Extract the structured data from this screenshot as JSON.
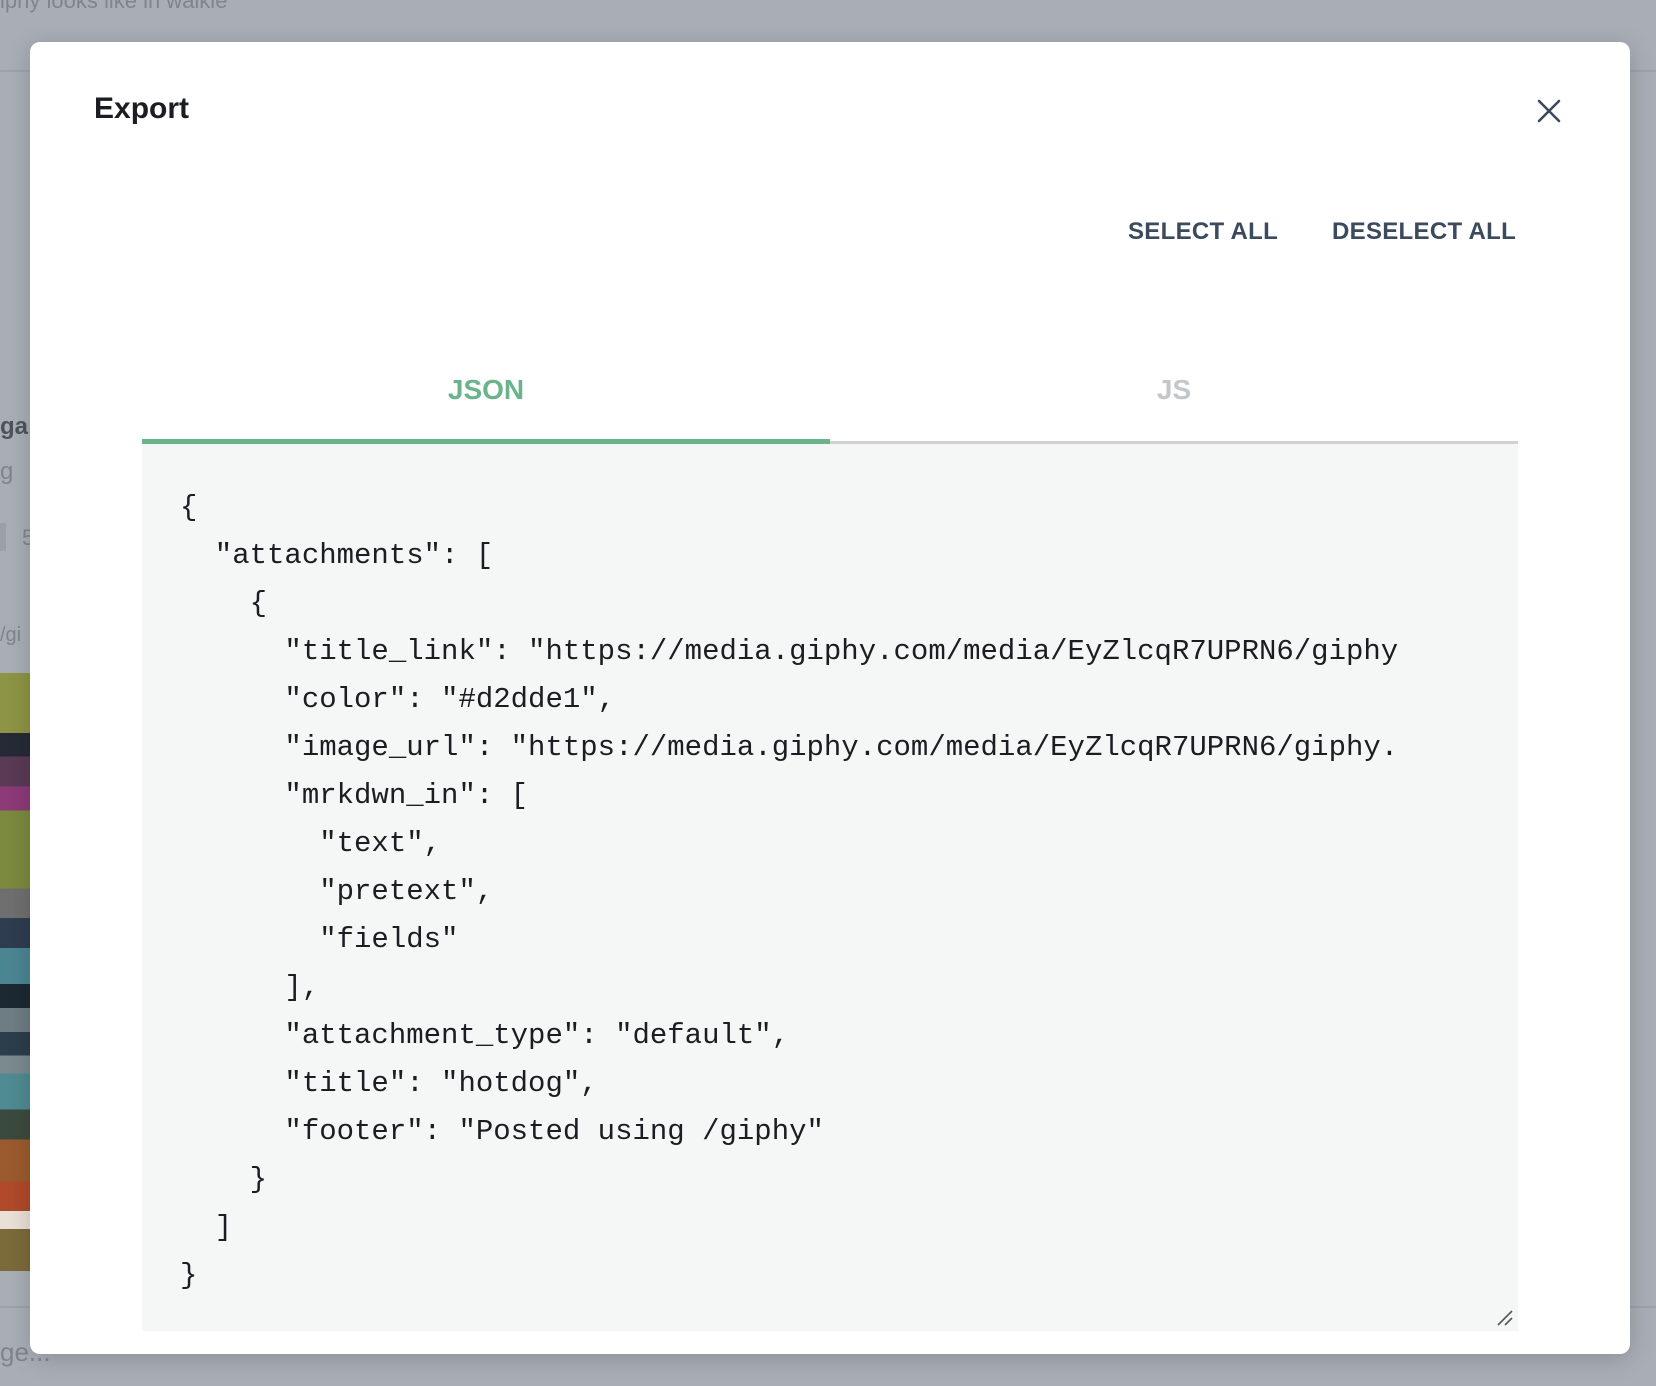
{
  "background": {
    "top_text": "iphy looks like in walkie",
    "user_name": "ga",
    "user_sub": "g",
    "chip_num": "5",
    "command": "/gi",
    "input_placeholder": "ge..."
  },
  "modal": {
    "title": "Export",
    "close_icon": "close-icon",
    "select_all_label": "SELECT ALL",
    "deselect_all_label": "DESELECT ALL",
    "tabs": [
      {
        "label": "JSON",
        "active": true
      },
      {
        "label": "JS",
        "active": false
      }
    ],
    "code_lines": [
      "{",
      "  \"attachments\": [",
      "    {",
      "      \"title_link\": \"https://media.giphy.com/media/EyZlcqR7UPRN6/giphy",
      "      \"color\": \"#d2dde1\",",
      "      \"image_url\": \"https://media.giphy.com/media/EyZlcqR7UPRN6/giphy.",
      "      \"mrkdwn_in\": [",
      "        \"text\",",
      "        \"pretext\",",
      "        \"fields\"",
      "      ],",
      "      \"attachment_type\": \"default\",",
      "      \"title\": \"hotdog\",",
      "      \"footer\": \"Posted using /giphy\"",
      "    }",
      "  ]",
      "}"
    ]
  },
  "colors": {
    "accent_green": "#6ab38b",
    "action_text": "#3b4a5c",
    "code_bg": "#f5f7f6",
    "overlay": "#a9aeb6"
  }
}
